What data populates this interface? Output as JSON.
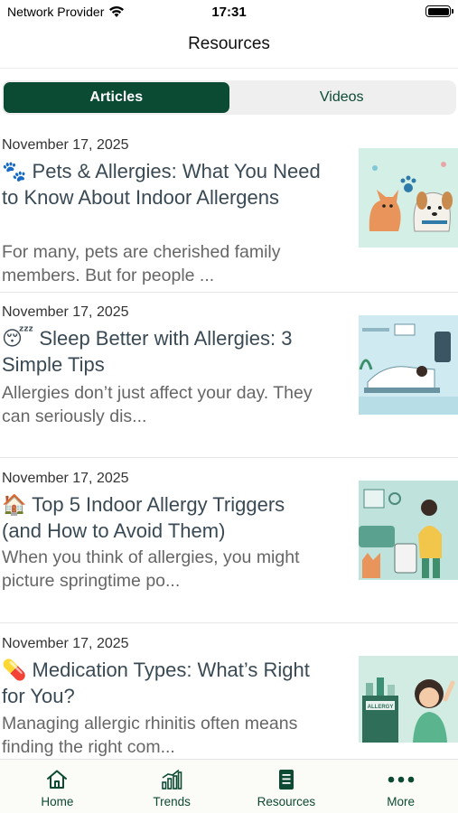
{
  "status_bar": {
    "carrier": "Network Provider",
    "time": "17:31"
  },
  "nav": {
    "title": "Resources"
  },
  "segments": [
    {
      "label": "Articles",
      "active": true
    },
    {
      "label": "Videos",
      "active": false
    }
  ],
  "articles": [
    {
      "date": "November 17, 2025",
      "emoji": "🐾",
      "title": "Pets & Allergies: What You Need to Know About Indoor Allergens",
      "excerpt": "For many, pets are cherished family members. But for people ..."
    },
    {
      "date": "November 17, 2025",
      "emoji": "😴",
      "title": "Sleep Better with Allergies: 3 Simple Tips",
      "excerpt": "Allergies don’t just affect your day. They can seriously dis..."
    },
    {
      "date": "November 17, 2025",
      "emoji": "🏠",
      "title": "Top 5 Indoor Allergy Triggers (and How to Avoid Them)",
      "excerpt": "When you think of allergies, you might picture springtime po..."
    },
    {
      "date": "November 17, 2025",
      "emoji": "💊",
      "title": "Medication Types: What’s Right for You?",
      "excerpt": "Managing allergic rhinitis often means finding the right com...",
      "thumb_text": "ALLERGY"
    }
  ],
  "tabs": [
    {
      "label": "Home",
      "icon": "house-icon"
    },
    {
      "label": "Trends",
      "icon": "chart-icon"
    },
    {
      "label": "Resources",
      "icon": "document-icon"
    },
    {
      "label": "More",
      "icon": "ellipsis-icon"
    }
  ],
  "colors": {
    "brand": "#0b4a33",
    "thumb_bg": "#d6efe8"
  }
}
